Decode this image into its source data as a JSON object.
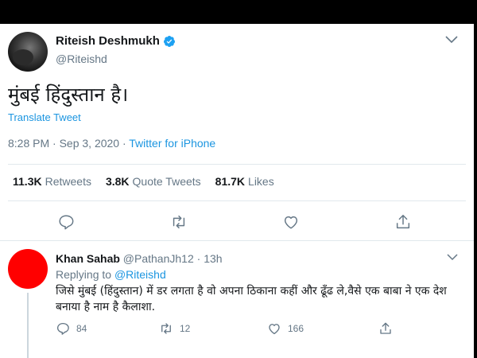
{
  "main_tweet": {
    "display_name": "Riteish Deshmukh",
    "handle": "@Riteishd",
    "text": "मुंबई हिंदुस्तान है।",
    "translate": "Translate Tweet",
    "timestamp": "8:28 PM · Sep 3, 2020 · ",
    "source": "Twitter for iPhone",
    "stats": {
      "retweets_count": "11.3K",
      "retweets_label": "Retweets",
      "quotes_count": "3.8K",
      "quotes_label": "Quote Tweets",
      "likes_count": "81.7K",
      "likes_label": "Likes"
    }
  },
  "reply": {
    "display_name": "Khan Sahab",
    "handle": "@PathanJh12",
    "time": " · 13h",
    "replying_prefix": "Replying to ",
    "replying_to": "@Riteishd",
    "text": "जिसे मुंबई (हिंदुस्तान) में डर लगता है वो अपना ठिकाना कहीं और ढूँढ ले,वैसे एक बाबा ने एक देश बनाया है नाम है कैलाशा.",
    "reply_count": "84",
    "retweet_count": "12",
    "like_count": "166"
  },
  "colors": {
    "accent": "#1b95e0",
    "muted": "#657786",
    "avatar_reply": "#ff0000"
  },
  "icons": [
    "verified-icon",
    "chevron-down-icon",
    "reply-icon",
    "retweet-icon",
    "like-icon",
    "share-icon"
  ]
}
